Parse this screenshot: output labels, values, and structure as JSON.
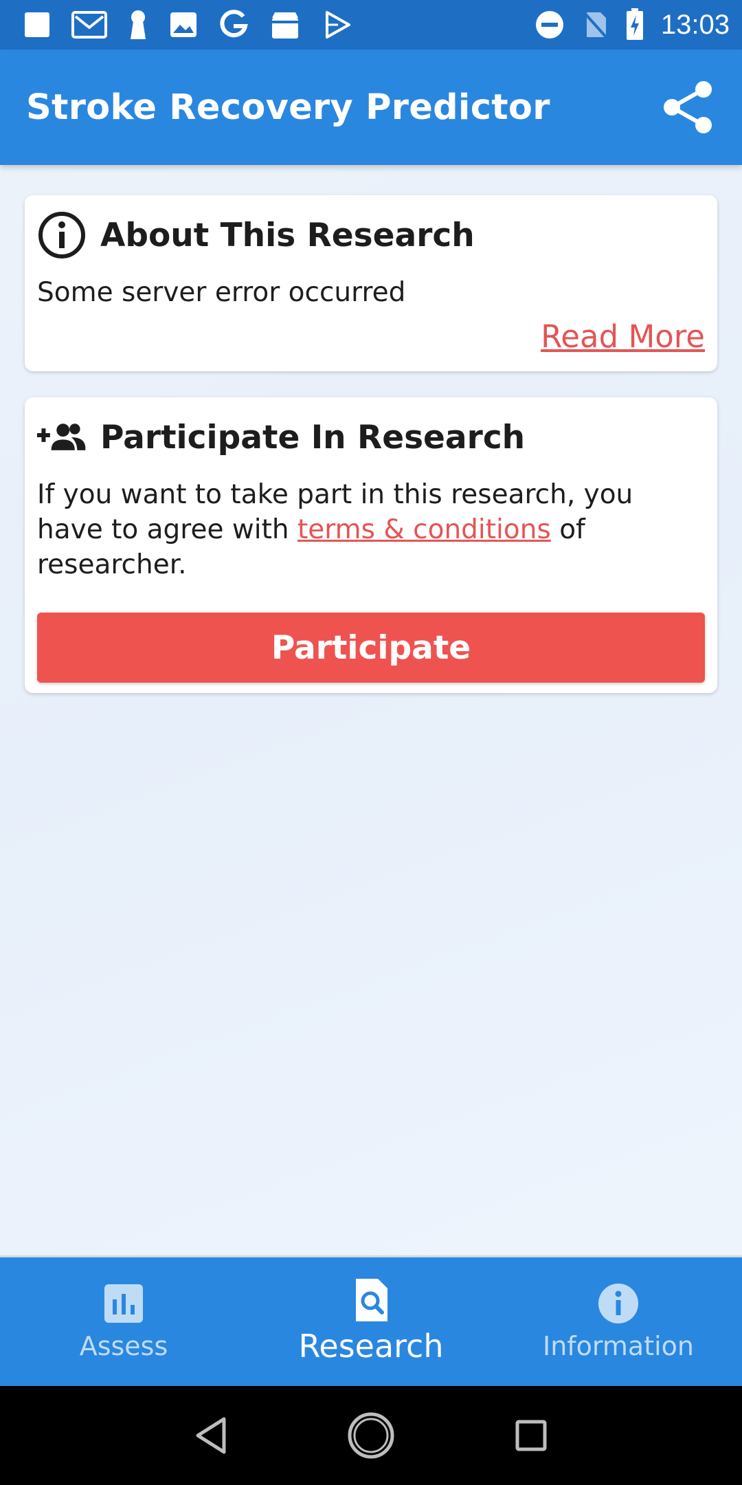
{
  "status_bar": {
    "time": "13:03",
    "left_icons": [
      "square-icon",
      "mail-icon",
      "keyhole-icon",
      "image-icon",
      "google-icon",
      "store-icon",
      "play-icon"
    ],
    "right_icons": [
      "do-not-disturb-icon",
      "no-sim-icon",
      "battery-charging-icon"
    ]
  },
  "app_bar": {
    "title": "Stroke Recovery Predictor",
    "share_icon": "share-icon",
    "color": "#2a87e0"
  },
  "about_card": {
    "title": "About This Research",
    "icon": "info-icon",
    "body": "Some server error occurred",
    "read_more": "Read More"
  },
  "participate_card": {
    "title": "Participate In Research",
    "icon": "add-group-icon",
    "body_before": "If you want to take part in this research, you have to agree with ",
    "link_text": "terms & conditions",
    "body_after": " of researcher.",
    "button_label": "Participate",
    "button_color": "#ef5350"
  },
  "bottom_nav": {
    "items": [
      {
        "label": "Assess",
        "icon": "bar-chart-icon",
        "active": false
      },
      {
        "label": "Research",
        "icon": "document-search-icon",
        "active": true
      },
      {
        "label": "Information",
        "icon": "info-circle-icon",
        "active": false
      }
    ]
  },
  "system_nav": [
    "back-icon",
    "home-icon",
    "recents-icon"
  ]
}
